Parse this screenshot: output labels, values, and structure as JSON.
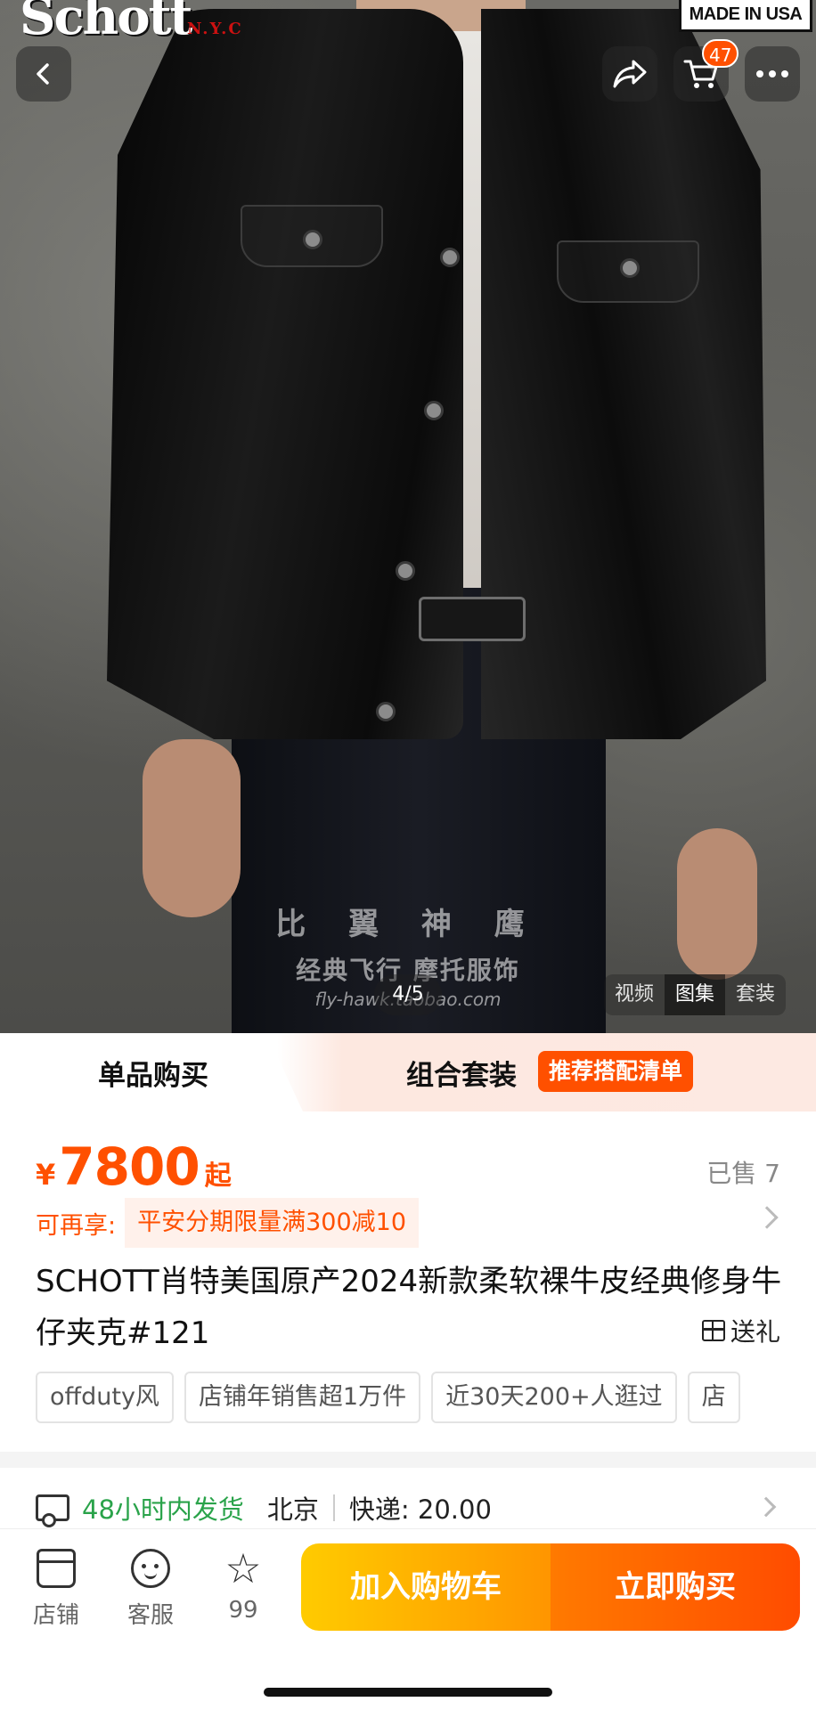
{
  "hero": {
    "brand_logo": "Schott",
    "brand_logo_sub": "N.Y.C",
    "made_in_usa": "MADE IN USA",
    "watermark_line1": "比 翼 神 鹰",
    "watermark_line2": "经典飞行 摩托服饰",
    "watermark_line3": "fly-hawk.taobao.com",
    "image_counter": "4/5",
    "media_tabs": [
      "视频",
      "图集",
      "套装"
    ],
    "media_tab_active": "图集"
  },
  "nav": {
    "back_icon": "chevron-left-icon",
    "share_icon": "share-arrow-icon",
    "cart_icon": "cart-icon",
    "cart_badge": "47",
    "more_icon": "more-dots-icon"
  },
  "purchase_mode": {
    "single": "单品购买",
    "combo": "组合套装",
    "combo_badge": "推荐搭配清单"
  },
  "price": {
    "currency": "¥",
    "amount": "7800",
    "suffix": "起",
    "sold": "已售 7"
  },
  "promo": {
    "lead": "可再享:",
    "chip": "平安分期限量满300减10"
  },
  "product": {
    "title": "SCHOTT肖特美国原产2024新款柔软裸牛皮经典修身牛仔夹克#121",
    "gift": "送礼"
  },
  "tags": [
    "offduty风",
    "店铺年销售超1万件",
    "近30天200+人逛过",
    "店"
  ],
  "shipping": {
    "fast": "48小时内发货",
    "city": "北京",
    "fee": "快递: 20.00"
  },
  "bottom_bar": {
    "shop": "店铺",
    "service": "客服",
    "fav_count": "99",
    "add_to_cart": "加入购物车",
    "buy_now": "立即购买"
  },
  "colors": {
    "accent": "#ff5000",
    "cart_gradient_start": "#ffcb00",
    "buy_gradient_end": "#ff4c00",
    "shipping_green": "#2aa34a"
  }
}
